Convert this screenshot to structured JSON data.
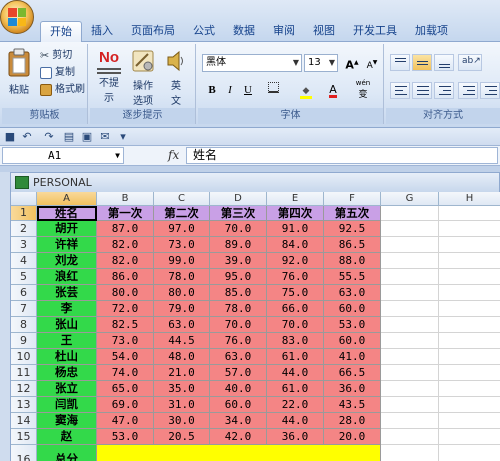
{
  "ribbon": {
    "tabs": [
      "开始",
      "插入",
      "页面布局",
      "公式",
      "数据",
      "审阅",
      "视图",
      "开发工具",
      "加载项"
    ],
    "active_tab": "开始",
    "clipboard": {
      "paste": "粘贴",
      "cut": "剪切",
      "copy": "复制",
      "format_painter": "格式刷",
      "title": "剪贴板"
    },
    "steps": {
      "no_prompt_line1": "不提",
      "no_prompt_line2": "示",
      "no_icon_text": "No",
      "ops_line1": "操作",
      "ops_line2": "选项",
      "english_line1": "英",
      "english_line2": "文",
      "title": "逐步提示"
    },
    "font": {
      "name": "黑体",
      "size": "13",
      "bold": "B",
      "italic": "I",
      "underline": "U",
      "grow": "A",
      "shrink": "A",
      "wen": "wén",
      "title": "字体"
    },
    "alignment": {
      "title": "对齐方式"
    }
  },
  "formula_bar": {
    "cell_ref": "A1",
    "fx": "fx",
    "content": "姓名"
  },
  "workbook": {
    "title": "PERSONAL"
  },
  "sheet": {
    "columns": [
      "A",
      "B",
      "C",
      "D",
      "E",
      "F",
      "G",
      "H"
    ],
    "row_numbers": [
      "1",
      "2",
      "3",
      "4",
      "5",
      "6",
      "7",
      "8",
      "9",
      "10",
      "11",
      "12",
      "13",
      "14",
      "15",
      "16"
    ],
    "header": [
      "姓名",
      "第一次",
      "第二次",
      "第三次",
      "第四次",
      "第五次"
    ],
    "rows": [
      [
        "胡开",
        "87.0",
        "97.0",
        "70.0",
        "91.0",
        "92.5"
      ],
      [
        "许祥",
        "82.0",
        "73.0",
        "89.0",
        "84.0",
        "86.5"
      ],
      [
        "刘龙",
        "82.0",
        "99.0",
        "39.0",
        "92.0",
        "88.0"
      ],
      [
        "浪红",
        "86.0",
        "78.0",
        "95.0",
        "76.0",
        "55.5"
      ],
      [
        "张芸",
        "80.0",
        "80.0",
        "85.0",
        "75.0",
        "63.0"
      ],
      [
        "李",
        "72.0",
        "79.0",
        "78.0",
        "66.0",
        "60.0"
      ],
      [
        "张山",
        "82.5",
        "63.0",
        "70.0",
        "70.0",
        "53.0"
      ],
      [
        "王",
        "73.0",
        "44.5",
        "76.0",
        "83.0",
        "60.0"
      ],
      [
        "杜山",
        "54.0",
        "48.0",
        "63.0",
        "61.0",
        "41.0"
      ],
      [
        "杨忠",
        "74.0",
        "21.0",
        "57.0",
        "44.0",
        "66.5"
      ],
      [
        "张立",
        "65.0",
        "35.0",
        "40.0",
        "61.0",
        "36.0"
      ],
      [
        "闫凯",
        "69.0",
        "31.0",
        "60.0",
        "22.0",
        "43.5"
      ],
      [
        "窦海",
        "47.0",
        "30.0",
        "34.0",
        "44.0",
        "28.0"
      ],
      [
        "赵",
        "53.0",
        "20.5",
        "42.0",
        "36.0",
        "20.0"
      ]
    ],
    "total_label": "总分"
  },
  "colors": {
    "name_fill": "#33d94a",
    "header_fill": "#c9a0e6",
    "score_fill": "#f48585",
    "total_fill": "#ffff00",
    "header_select": "#f1c15f"
  }
}
